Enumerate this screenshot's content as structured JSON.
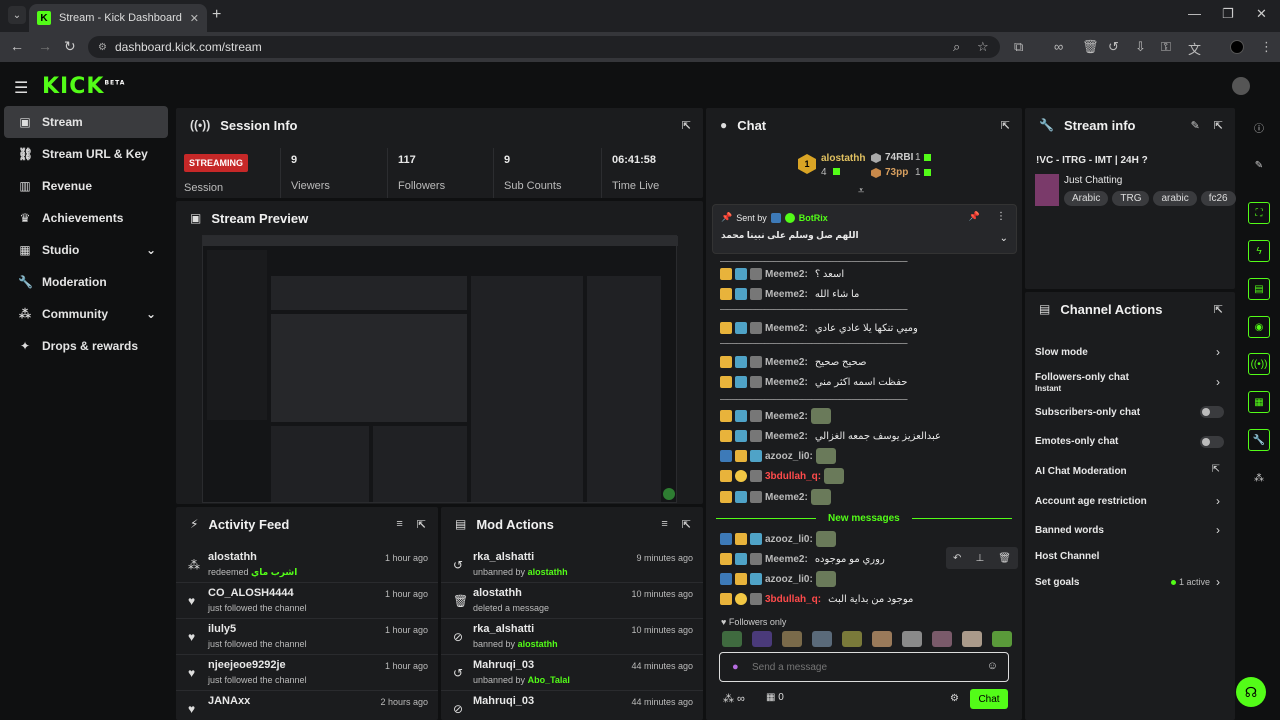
{
  "browser": {
    "tab_title": "Stream - Kick Dashboard",
    "url": "dashboard.kick.com/stream"
  },
  "brand": {
    "logo": "KICK",
    "beta": "BETA",
    "accent": "#53fc18"
  },
  "sidebar": {
    "items": [
      {
        "label": "Stream",
        "icon": "video-icon",
        "active": true
      },
      {
        "label": "Stream URL & Key",
        "icon": "link-icon"
      },
      {
        "label": "Revenue",
        "icon": "chart-icon"
      },
      {
        "label": "Achievements",
        "icon": "trophy-icon"
      },
      {
        "label": "Studio",
        "icon": "studio-icon",
        "expandable": true
      },
      {
        "label": "Moderation",
        "icon": "wrench-icon"
      },
      {
        "label": "Community",
        "icon": "community-icon",
        "expandable": true
      },
      {
        "label": "Drops & rewards",
        "icon": "gift-icon"
      }
    ]
  },
  "session": {
    "title": "Session Info",
    "status": "STREAMING",
    "status_label": "Session",
    "viewers": "9",
    "viewers_label": "Viewers",
    "followers": "117",
    "followers_label": "Followers",
    "subs": "9",
    "subs_label": "Sub Counts",
    "time": "06:41:58",
    "time_label": "Time Live"
  },
  "preview": {
    "title": "Stream Preview"
  },
  "activity": {
    "title": "Activity Feed",
    "rows": [
      {
        "name": "alostathh",
        "sub": "redeemed",
        "extra": "اشرب ماي",
        "time": "1 hour ago",
        "icon": "redeem-icon"
      },
      {
        "name": "CO_ALOSH4444",
        "sub": "just followed the channel",
        "time": "1 hour ago",
        "icon": "heart-icon"
      },
      {
        "name": "iluly5",
        "sub": "just followed the channel",
        "time": "1 hour ago",
        "icon": "heart-icon"
      },
      {
        "name": "njeejeoe9292je",
        "sub": "just followed the channel",
        "time": "1 hour ago",
        "icon": "heart-icon"
      },
      {
        "name": "JANAxx",
        "sub": "",
        "time": "2 hours ago",
        "icon": "heart-icon"
      }
    ]
  },
  "mod": {
    "title": "Mod Actions",
    "rows": [
      {
        "name": "rka_alshatti",
        "sub": "unbanned by",
        "by": "alostathh",
        "time": "9 minutes ago",
        "icon": "undo-icon"
      },
      {
        "name": "alostathh",
        "sub": "deleted a message",
        "by": "",
        "time": "10 minutes ago",
        "icon": "trash-icon"
      },
      {
        "name": "rka_alshatti",
        "sub": "banned by",
        "by": "alostathh",
        "time": "10 minutes ago",
        "icon": "ban-icon"
      },
      {
        "name": "Mahruqi_03",
        "sub": "unbanned by",
        "by": "Abo_Talal",
        "time": "44 minutes ago",
        "icon": "undo-icon"
      },
      {
        "name": "Mahruqi_03",
        "sub": "",
        "by": "",
        "time": "44 minutes ago",
        "icon": "ban-icon"
      }
    ]
  },
  "chat": {
    "title": "Chat",
    "gifters": [
      {
        "name": "alostathh",
        "count": "4"
      },
      {
        "name": "74RBI",
        "count": "1"
      },
      {
        "name": "73pp",
        "count": "1"
      }
    ],
    "pinned_sent_by": "Sent by",
    "pinned_bot": "BotRix",
    "pinned_text": "اللهم صل وسلم على نبينا محمد",
    "messages": [
      {
        "user": "Meeme2:",
        "text": "اسعد ؟"
      },
      {
        "user": "Meeme2:",
        "text": "ما شاء الله"
      },
      {
        "user": "Meeme2:",
        "text": "وميي تنكها يلا عادي عادي"
      },
      {
        "user": "Meeme2:",
        "text": "صحيح صحيح"
      },
      {
        "user": "Meeme2:",
        "text": "حفظت اسمه اكثر مني"
      },
      {
        "user": "Meeme2:",
        "text": ""
      },
      {
        "user": "Meeme2:",
        "text": "عبدالعزيز يوسف جمعه الغزالي"
      },
      {
        "user": "azooz_li0:",
        "text": ""
      },
      {
        "user": "3bdullah_q:",
        "text": ""
      },
      {
        "user": "Meeme2:",
        "text": ""
      }
    ],
    "new_messages": "New messages",
    "messages2": [
      {
        "user": "azooz_li0:",
        "text": ""
      },
      {
        "user": "Meeme2:",
        "text": "روري مو موجوده"
      },
      {
        "user": "azooz_li0:",
        "text": ""
      },
      {
        "user": "3bdullah_q:",
        "text": "موجود من بداية البث"
      }
    ],
    "followers_only": "Followers only",
    "input_placeholder": "Send a message",
    "points": "0",
    "send": "Chat"
  },
  "stream_info": {
    "title": "Stream info",
    "stream_title": "!VC - ITRG - IMT | 24H ?",
    "category": "Just Chatting",
    "tags": [
      "Arabic",
      "TRG",
      "arabic",
      "fc26"
    ]
  },
  "channel_actions": {
    "title": "Channel Actions",
    "slow_mode": "Slow mode",
    "followers_only": "Followers-only chat",
    "followers_only_sub": "Instant",
    "subs_only": "Subscribers-only chat",
    "emotes_only": "Emotes-only chat",
    "ai_mod": "AI Chat Moderation",
    "age": "Account age restriction",
    "banned": "Banned words",
    "host": "Host Channel",
    "goals": "Set goals",
    "goals_status": "1 active"
  }
}
